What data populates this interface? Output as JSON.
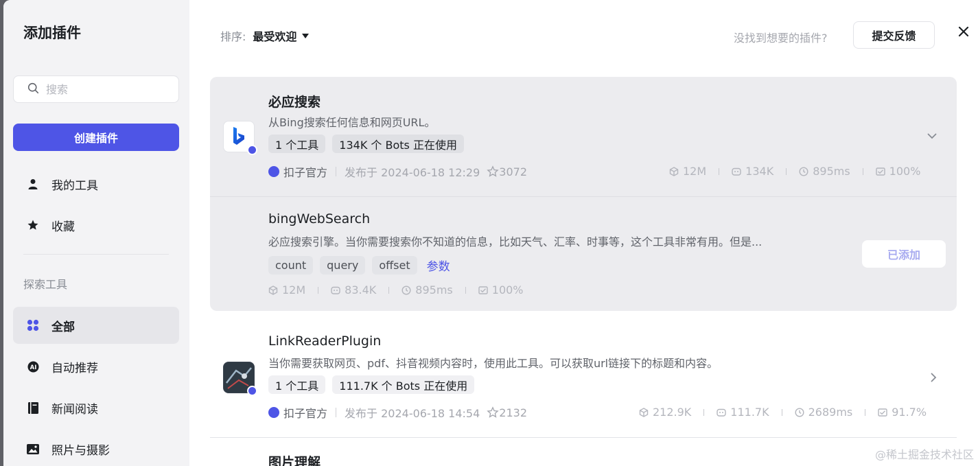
{
  "sidebar": {
    "title": "添加插件",
    "search_placeholder": "搜索",
    "create_label": "创建插件",
    "top_items": [
      {
        "label": "我的工具",
        "icon": "user-icon"
      },
      {
        "label": "收藏",
        "icon": "star-icon"
      }
    ],
    "section_label": "探索工具",
    "categories": [
      {
        "label": "全部",
        "icon": "grid-icon",
        "active": true
      },
      {
        "label": "自动推荐",
        "icon": "ai-icon",
        "active": false
      },
      {
        "label": "新闻阅读",
        "icon": "book-icon",
        "active": false
      },
      {
        "label": "照片与摄影",
        "icon": "photo-icon",
        "active": false
      }
    ]
  },
  "header": {
    "sort_label": "排序:",
    "sort_value": "最受欢迎",
    "not_found_text": "没找到想要的插件?",
    "feedback_label": "提交反馈"
  },
  "plugins": [
    {
      "name": "必应搜索",
      "description": "从Bing搜索任何信息和网页URL。",
      "tags": [
        "1 个工具",
        "134K 个 Bots 正在使用"
      ],
      "publisher": "扣子官方",
      "published": "发布于 2024-06-18 12:29",
      "stars": "3072",
      "stats": {
        "calls": "12M",
        "bots": "134K",
        "latency": "895ms",
        "success": "100%"
      },
      "expanded": true,
      "tool": {
        "name": "bingWebSearch",
        "description": "必应搜索引擎。当你需要搜索你不知道的信息，比如天气、汇率、时事等，这个工具非常有用。但是...",
        "params": [
          "count",
          "query",
          "offset"
        ],
        "params_link": "参数",
        "stats": {
          "calls": "12M",
          "bots": "83.4K",
          "latency": "895ms",
          "success": "100%"
        },
        "added_label": "已添加"
      }
    },
    {
      "name": "LinkReaderPlugin",
      "description": "当你需要获取网页、pdf、抖音视频内容时，使用此工具。可以获取url链接下的标题和内容。",
      "tags": [
        "1 个工具",
        "111.7K 个 Bots 正在使用"
      ],
      "publisher": "扣子官方",
      "published": "发布于 2024-06-18 14:54",
      "stars": "2132",
      "stats": {
        "calls": "212.9K",
        "bots": "111.7K",
        "latency": "2689ms",
        "success": "91.7%"
      },
      "expanded": false
    },
    {
      "name": "图片理解"
    }
  ],
  "watermark": "@稀土掘金技术社区",
  "colors": {
    "accent": "#4e55e6",
    "sidebar_bg": "#f3f3f5",
    "expanded_bg": "#ececef"
  }
}
